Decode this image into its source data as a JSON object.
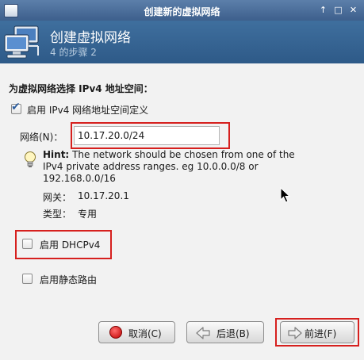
{
  "window": {
    "title": "创建新的虚拟网络"
  },
  "header": {
    "title": "创建虚拟网络",
    "step": "4 的步骤 2"
  },
  "form": {
    "section_label": "为虚拟网络选择 IPv4 地址空间：",
    "enable_ipv4": {
      "label": "启用 IPv4 网络地址空间定义",
      "checked": true
    },
    "network": {
      "label": "网络(N)：",
      "value": "10.17.20.0/24"
    },
    "hint": {
      "label": "Hint:",
      "text": "The network should be chosen from one of the IPv4 private address ranges. eg 10.0.0.0/8 or 192.168.0.0/16"
    },
    "gateway": {
      "label": "网关：",
      "value": "10.17.20.1"
    },
    "type": {
      "label": "类型：",
      "value": "专用"
    },
    "enable_dhcp": {
      "label": "启用 DHCPv4",
      "checked": false
    },
    "enable_static_route": {
      "label": "启用静态路由",
      "checked": false
    }
  },
  "buttons": {
    "cancel": "取消(C)",
    "back": "后退(B)",
    "forward": "前进(F)"
  },
  "colors": {
    "highlight": "#d6201e",
    "header_bg": "#2e5a88",
    "accent": "#2f5f9e"
  }
}
